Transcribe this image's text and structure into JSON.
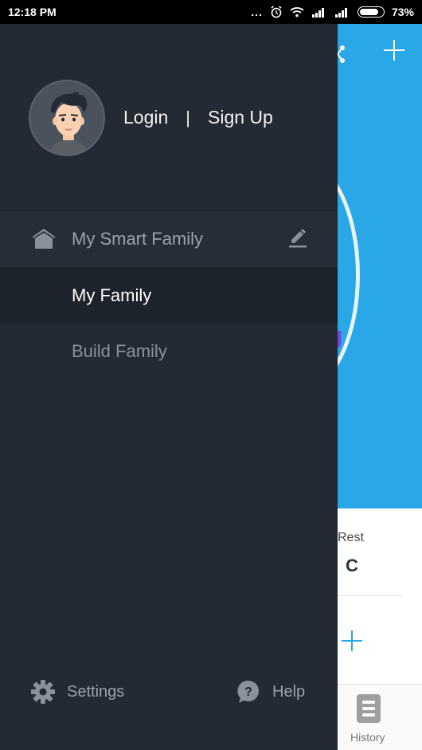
{
  "status_bar": {
    "time": "12:18 PM",
    "dots": "...",
    "battery_percent": "73%",
    "battery_level": 0.73
  },
  "drawer": {
    "auth": {
      "login": "Login",
      "separator": "|",
      "signup": "Sign Up"
    },
    "items": [
      {
        "label": "My Smart Family",
        "icon": "home-icon",
        "trailing_icon": "edit-icon"
      },
      {
        "label": "My Family",
        "selected": true
      },
      {
        "label": "Build Family"
      }
    ],
    "footer": {
      "settings": "Settings",
      "help": "Help"
    }
  },
  "background_app": {
    "rest_label": "Rest",
    "rest_value": "C",
    "nav_history": "History",
    "colors": {
      "header": "#29a7e6",
      "accent": "#7b3fe4"
    }
  }
}
